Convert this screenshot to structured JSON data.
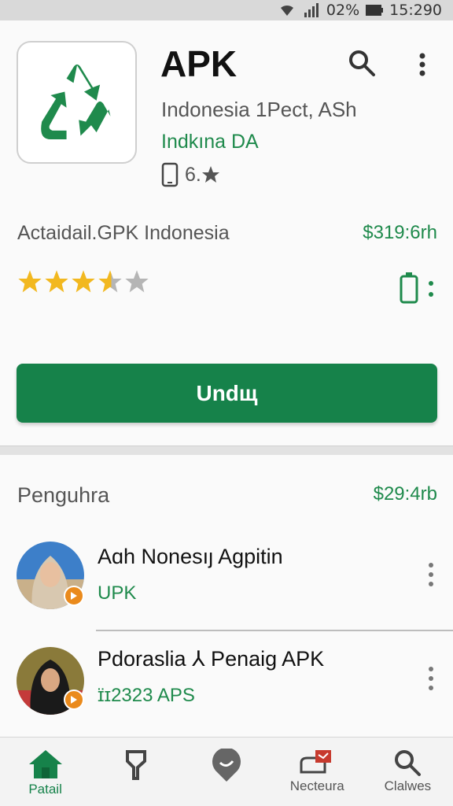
{
  "status_bar": {
    "battery": "02%",
    "time": "15:290"
  },
  "app": {
    "title": "APK",
    "developer": "Indonesia 1Pect, ASh",
    "publisher": "Indkına DA",
    "rating_text": "6.",
    "subtitle": "Actaidail.GPK Indonesia",
    "price": "$319:6rh",
    "stars": 4,
    "install_label": "Undщ"
  },
  "section": {
    "title": "Penguhra",
    "price": "$29:4rb",
    "items": [
      {
        "title": "Aɑh Nonesıȷ Agpitin",
        "subtitle": "UPK"
      },
      {
        "title": "Pdoraslia ⅄ Penaig APK",
        "subtitle": "ɪ̈ɪ2323 APS"
      }
    ]
  },
  "nav": [
    {
      "label": "Patail",
      "icon": "home-icon"
    },
    {
      "label": "",
      "icon": "bookmark-icon"
    },
    {
      "label": "",
      "icon": "location-icon"
    },
    {
      "label": "Necteura",
      "icon": "notification-icon"
    },
    {
      "label": "Clalwes",
      "icon": "search-icon"
    }
  ],
  "colors": {
    "accent": "#16824a",
    "badge": "#ea8a1c",
    "star": "#f2b81f"
  }
}
